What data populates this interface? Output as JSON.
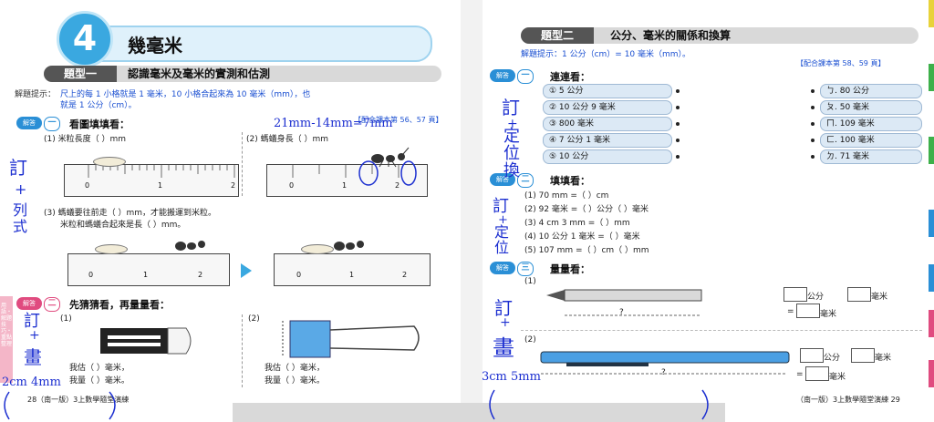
{
  "left": {
    "chapter_number": "4",
    "chapter_title": "幾毫米",
    "type_tag": "題型一",
    "type_title": "認識毫米及毫米的實測和估測",
    "hint_label": "解題提示：",
    "hint_text_1": "尺上的每 1 小格就是 1 毫米，10 小格合起來為 10 毫米（mm），也",
    "hint_text_2": "就是 1 公分（cm）。",
    "ref": "【配合課本第 56、57 頁】",
    "sec1_tag": "解答",
    "sec1_num": "一",
    "sec1_title": "看圖填填看：",
    "q1": "(1)  米粒長度（                ）mm",
    "q2": "(2)  螞蟻身長（                ）mm",
    "q3_line1": "(3)  螞蟻要往前走（            ）mm，才能搬運到米粒。",
    "q3_line2": "米粒和螞蟻合起來是長（            ）mm。",
    "sec2_tag": "解答",
    "sec2_num": "二",
    "sec2_title": "先猜猜看，再量量看：",
    "sub1": "(1)",
    "sub2": "(2)",
    "est_label": "我估（          ）毫米，",
    "meas_label": "我量（          ）毫米。",
    "footer": "28（南一版）3上數學隨堂演練",
    "side_tab": "用語・解題技巧・重點整理",
    "ruler_nums": [
      "0",
      "1",
      "2"
    ]
  },
  "right": {
    "type_tag": "題型二",
    "type_title": "公分、毫米的關係和換算",
    "hint": "解題提示：1 公分（cm）= 10 毫米（mm）。",
    "ref": "【配合課本第 58、59 頁】",
    "sec1_tag": "解答",
    "sec1_num": "一",
    "sec1_title": "連連看：",
    "left_items": [
      "① 5 公分",
      "② 10 公分 9 毫米",
      "③ 800 毫米",
      "④ 7 公分 1 毫米",
      "⑤ 10 公分"
    ],
    "right_items": [
      "ㄅ. 80 公分",
      "ㄆ. 50 毫米",
      "ㄇ. 109 毫米",
      "ㄈ. 100 毫米",
      "ㄉ. 71 毫米"
    ],
    "sec2_tag": "解答",
    "sec2_num": "二",
    "sec2_title": "填填看：",
    "fill": [
      "(1)  70 mm =（            ）cm",
      "(2)  92 毫米 =（            ）公分（            ）毫米",
      "(3)  4 cm 3 mm =（            ）mm",
      "(4)  10 公分 1 毫米 =（            ）毫米",
      "(5)  107 mm =（            ）cm（            ）mm"
    ],
    "sec3_tag": "解答",
    "sec3_num": "三",
    "sec3_title": "量量看：",
    "m1": "(1)",
    "m2": "(2)",
    "gong_fen": "公分",
    "hao_mi": "毫米",
    "eq": "=",
    "question_mark": "?",
    "footer": "（南一版）3上數學隨堂演練 29"
  },
  "handwriting": {
    "top_note": "21mm-14mm=7mm",
    "left_note_1": "訂",
    "left_note_2": "+",
    "left_note_3": "列式",
    "left_note_4": "訂",
    "left_note_5": "+",
    "left_note_6": "畫",
    "left_bottom": "2cm 4mm",
    "right_note_1": "訂",
    "right_note_2": "+",
    "right_note_3": "定位換",
    "right_note_4": "訂",
    "right_note_5": "+",
    "right_note_6": "定位",
    "right_note_7": "訂",
    "right_note_8": "+",
    "right_note_9": "畫",
    "right_bottom": "3cm 5mm"
  },
  "colors": {
    "accent_blue": "#2a8fd6",
    "accent_pink": "#e04b7f",
    "hint_blue": "#1a4fd1",
    "ink_blue": "#1c2fd0"
  },
  "right_edge_tabs": [
    "#e8d23a",
    "#3db04a",
    "#3db04a",
    "#2a8fd6",
    "#2a8fd6",
    "#e04b7f",
    "#e04b7f"
  ]
}
